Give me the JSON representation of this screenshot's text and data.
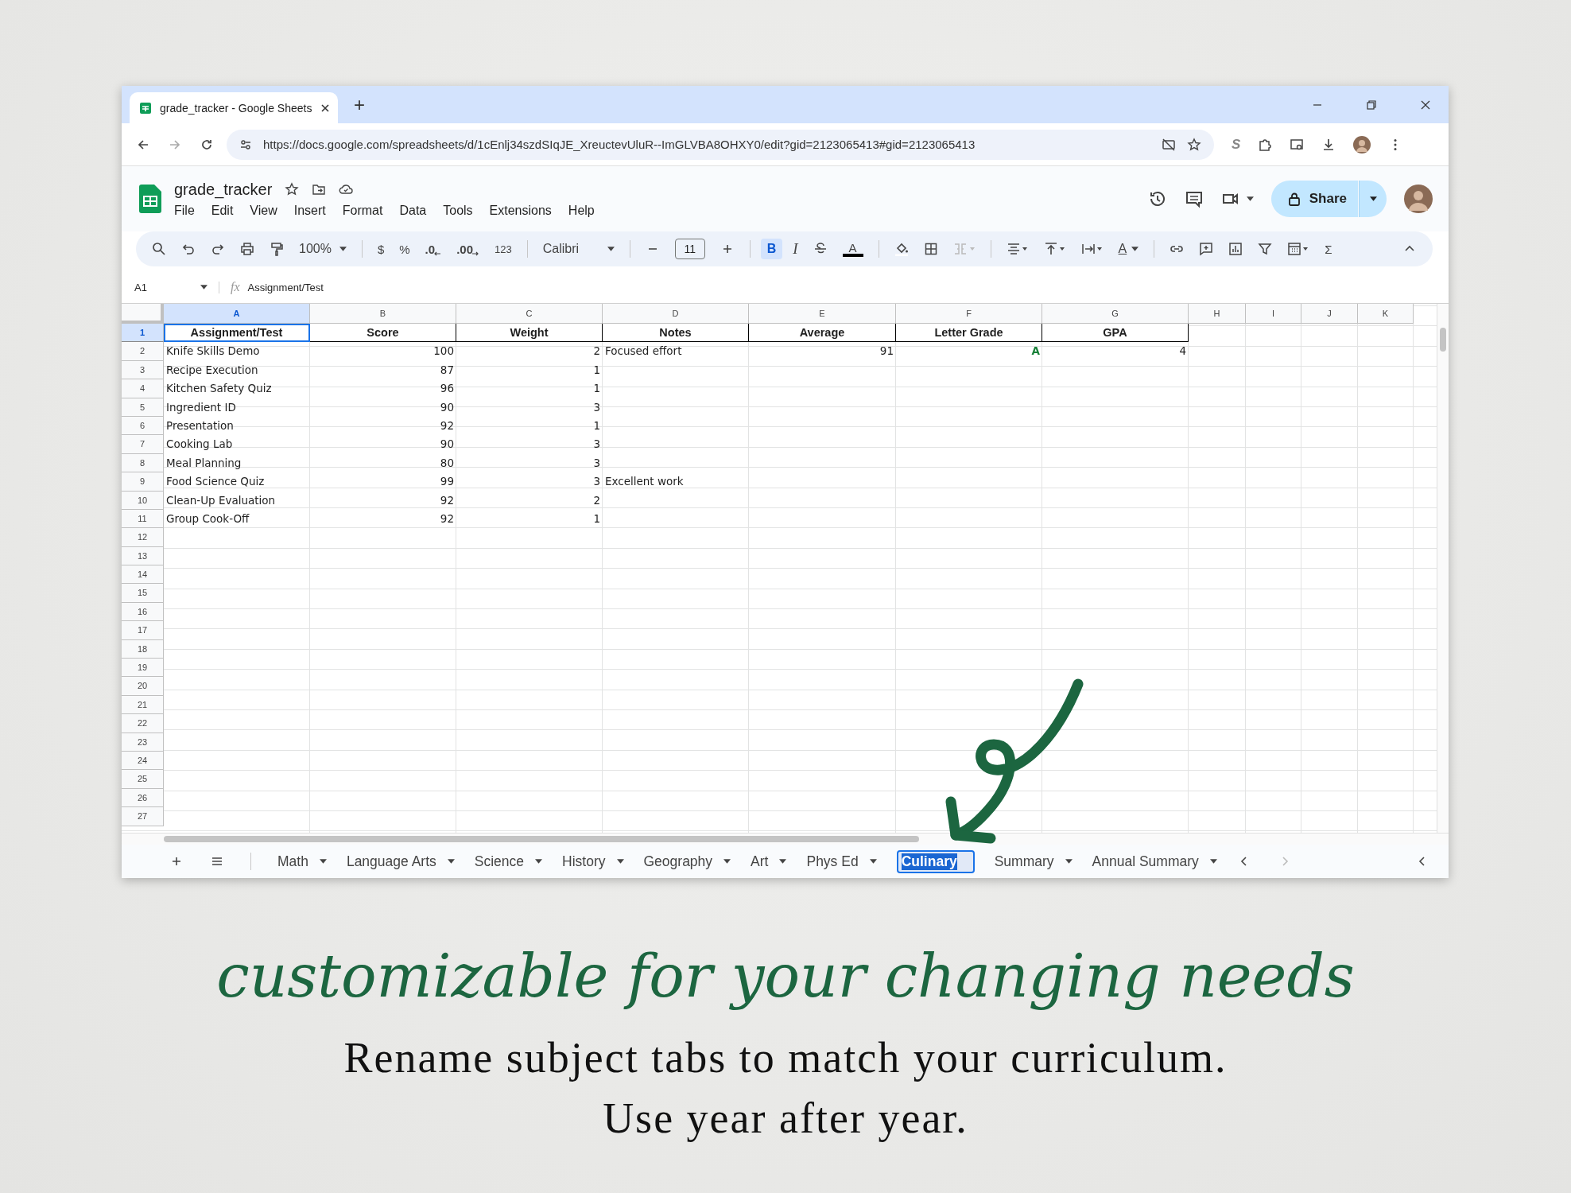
{
  "browser": {
    "tab_title": "grade_tracker - Google Sheets",
    "new_tab": "+",
    "url": "https://docs.google.com/spreadsheets/d/1cEnlj34szdSIqJE_XreuctevUluR--ImGLVBA8OHXY0/edit?gid=2123065413#gid=2123065413",
    "extension_letter": "S"
  },
  "sheets_header": {
    "title": "grade_tracker",
    "menu": [
      "File",
      "Edit",
      "View",
      "Insert",
      "Format",
      "Data",
      "Tools",
      "Extensions",
      "Help"
    ],
    "share": "Share"
  },
  "toolbar": {
    "zoom": "100%",
    "currency": "$",
    "percent": "%",
    "decrease_decimals": ".0",
    "increase_decimals": ".00",
    "number_format": "123",
    "font": "Calibri",
    "font_size": "11",
    "bold": "B",
    "bold_on": true,
    "italic": "I",
    "text_color": "A",
    "text_format": "A",
    "functions": "Σ"
  },
  "formula_bar": {
    "cell": "A1",
    "fx": "fx",
    "value": "Assignment/Test"
  },
  "columns": [
    {
      "label": "A",
      "selected": true
    },
    {
      "label": "B",
      "selected": false
    },
    {
      "label": "C",
      "selected": false
    },
    {
      "label": "D",
      "selected": false
    },
    {
      "label": "E",
      "selected": false
    },
    {
      "label": "F",
      "selected": false
    },
    {
      "label": "G",
      "selected": false
    },
    {
      "label": "H",
      "selected": false
    },
    {
      "label": "I",
      "selected": false
    },
    {
      "label": "J",
      "selected": false
    },
    {
      "label": "K",
      "selected": false
    }
  ],
  "rows": [
    {
      "number": "1",
      "selected": true,
      "kind": "header",
      "cells": [
        "Assignment/Test",
        "Score",
        "Weight",
        "Notes",
        "Average",
        "Letter Grade",
        "GPA"
      ]
    },
    {
      "number": "2",
      "selected": false,
      "kind": "data",
      "cells": [
        "Knife Skills Demo",
        "100",
        "2",
        "Focused effort",
        "91",
        {
          "text": "A",
          "color": "#188038"
        },
        "4"
      ]
    },
    {
      "number": "3",
      "selected": false,
      "kind": "data",
      "cells": [
        "Recipe Execution",
        "87",
        "1"
      ]
    },
    {
      "number": "4",
      "selected": false,
      "kind": "data",
      "cells": [
        "Kitchen Safety Quiz",
        "96",
        "1"
      ]
    },
    {
      "number": "5",
      "selected": false,
      "kind": "data",
      "cells": [
        "Ingredient ID",
        "90",
        "3"
      ]
    },
    {
      "number": "6",
      "selected": false,
      "kind": "data",
      "cells": [
        "Presentation",
        "92",
        "1"
      ]
    },
    {
      "number": "7",
      "selected": false,
      "kind": "data",
      "cells": [
        "Cooking Lab",
        "90",
        "3"
      ]
    },
    {
      "number": "8",
      "selected": false,
      "kind": "data",
      "cells": [
        "Meal Planning",
        "80",
        "3"
      ]
    },
    {
      "number": "9",
      "selected": false,
      "kind": "data",
      "cells": [
        "Food Science Quiz",
        "99",
        "3",
        "Excellent work"
      ]
    },
    {
      "number": "10",
      "selected": false,
      "kind": "data",
      "cells": [
        "Clean-Up Evaluation",
        "92",
        "2"
      ]
    },
    {
      "number": "11",
      "selected": false,
      "kind": "data",
      "cells": [
        "Group Cook-Off",
        "92",
        "1"
      ]
    },
    {
      "number": "12",
      "selected": false,
      "kind": "data",
      "cells": []
    },
    {
      "number": "13",
      "selected": false,
      "kind": "data",
      "cells": []
    },
    {
      "number": "14",
      "selected": false,
      "kind": "data",
      "cells": []
    },
    {
      "number": "15",
      "selected": false,
      "kind": "data",
      "cells": []
    },
    {
      "number": "16",
      "selected": false,
      "kind": "data",
      "cells": []
    },
    {
      "number": "17",
      "selected": false,
      "kind": "data",
      "cells": []
    },
    {
      "number": "18",
      "selected": false,
      "kind": "data",
      "cells": []
    },
    {
      "number": "19",
      "selected": false,
      "kind": "data",
      "cells": []
    },
    {
      "number": "20",
      "selected": false,
      "kind": "data",
      "cells": []
    },
    {
      "number": "21",
      "selected": false,
      "kind": "data",
      "cells": []
    },
    {
      "number": "22",
      "selected": false,
      "kind": "data",
      "cells": []
    },
    {
      "number": "23",
      "selected": false,
      "kind": "data",
      "cells": []
    },
    {
      "number": "24",
      "selected": false,
      "kind": "data",
      "cells": []
    },
    {
      "number": "25",
      "selected": false,
      "kind": "data",
      "cells": []
    },
    {
      "number": "26",
      "selected": false,
      "kind": "data",
      "cells": []
    },
    {
      "number": "27",
      "selected": false,
      "kind": "data",
      "cells": []
    }
  ],
  "sheet_tabs": [
    {
      "label": "Math",
      "selected": false
    },
    {
      "label": "Language Arts",
      "selected": false
    },
    {
      "label": "Science",
      "selected": false
    },
    {
      "label": "History",
      "selected": false
    },
    {
      "label": "Geography",
      "selected": false
    },
    {
      "label": "Art",
      "selected": false
    },
    {
      "label": "Phys Ed",
      "selected": false
    },
    {
      "label": "Culinary",
      "selected": true
    },
    {
      "label": "Summary",
      "selected": false
    },
    {
      "label": "Annual Summary",
      "selected": false
    }
  ],
  "caption": {
    "headline": "customizable for your changing needs",
    "lines": [
      "Rename subject tabs to match your curriculum.",
      "Use year after year."
    ]
  }
}
